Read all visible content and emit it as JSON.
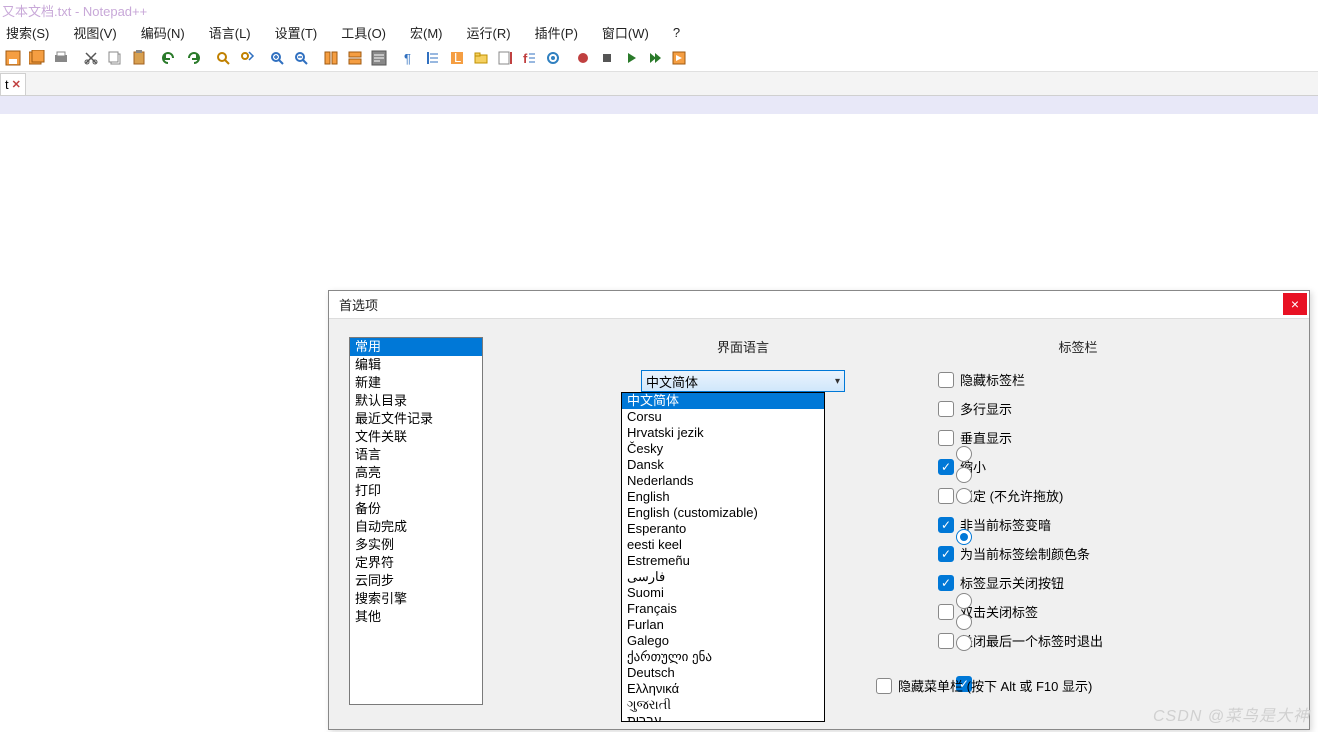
{
  "titlebar": "又本文档.txt - Notepad++",
  "menu": [
    "搜索(S)",
    "视图(V)",
    "编码(N)",
    "语言(L)",
    "设置(T)",
    "工具(O)",
    "宏(M)",
    "运行(R)",
    "插件(P)",
    "窗口(W)",
    "?"
  ],
  "tab": {
    "label": "t",
    "close": "✕"
  },
  "dialog": {
    "title": "首选项",
    "categories": [
      "常用",
      "编辑",
      "新建",
      "默认目录",
      "最近文件记录",
      "文件关联",
      "语言",
      "高亮",
      "打印",
      "备份",
      "自动完成",
      "多实例",
      "定界符",
      "云同步",
      "搜索引擎",
      "其他"
    ],
    "selected_category_index": 0,
    "lang_section_title": "界面语言",
    "combo_value": "中文简体",
    "lang_options": [
      "中文简体",
      "Corsu",
      "Hrvatski jezik",
      "Česky",
      "Dansk",
      "Nederlands",
      "English",
      "English (customizable)",
      "Esperanto",
      "eesti keel",
      "Estremeñu",
      "فارسی",
      "Suomi",
      "Français",
      "Furlan",
      "Galego",
      "ქართული ენა",
      "Deutsch",
      "Ελληνικά",
      "ગુજરાતી",
      "עברית"
    ],
    "selected_lang_index": 0,
    "tab_section_title": "标签栏",
    "tab_checks": [
      {
        "label": "隐藏标签栏",
        "checked": false
      },
      {
        "label": "多行显示",
        "checked": false
      },
      {
        "label": "垂直显示",
        "checked": false
      },
      {
        "label": "缩小",
        "checked": true
      },
      {
        "label": "锁定 (不允许拖放)",
        "checked": false
      },
      {
        "label": "非当前标签变暗",
        "checked": true
      },
      {
        "label": "为当前标签绘制颜色条",
        "checked": true
      },
      {
        "label": "标签显示关闭按钮",
        "checked": true
      },
      {
        "label": "双击关闭标签",
        "checked": false
      },
      {
        "label": "关闭最后一个标签时退出",
        "checked": false
      }
    ],
    "bottom_check": {
      "label": "隐藏菜单栏 (按下 Alt 或 F10 显示)",
      "checked": false
    }
  },
  "watermark": "CSDN @菜鸟是大神"
}
